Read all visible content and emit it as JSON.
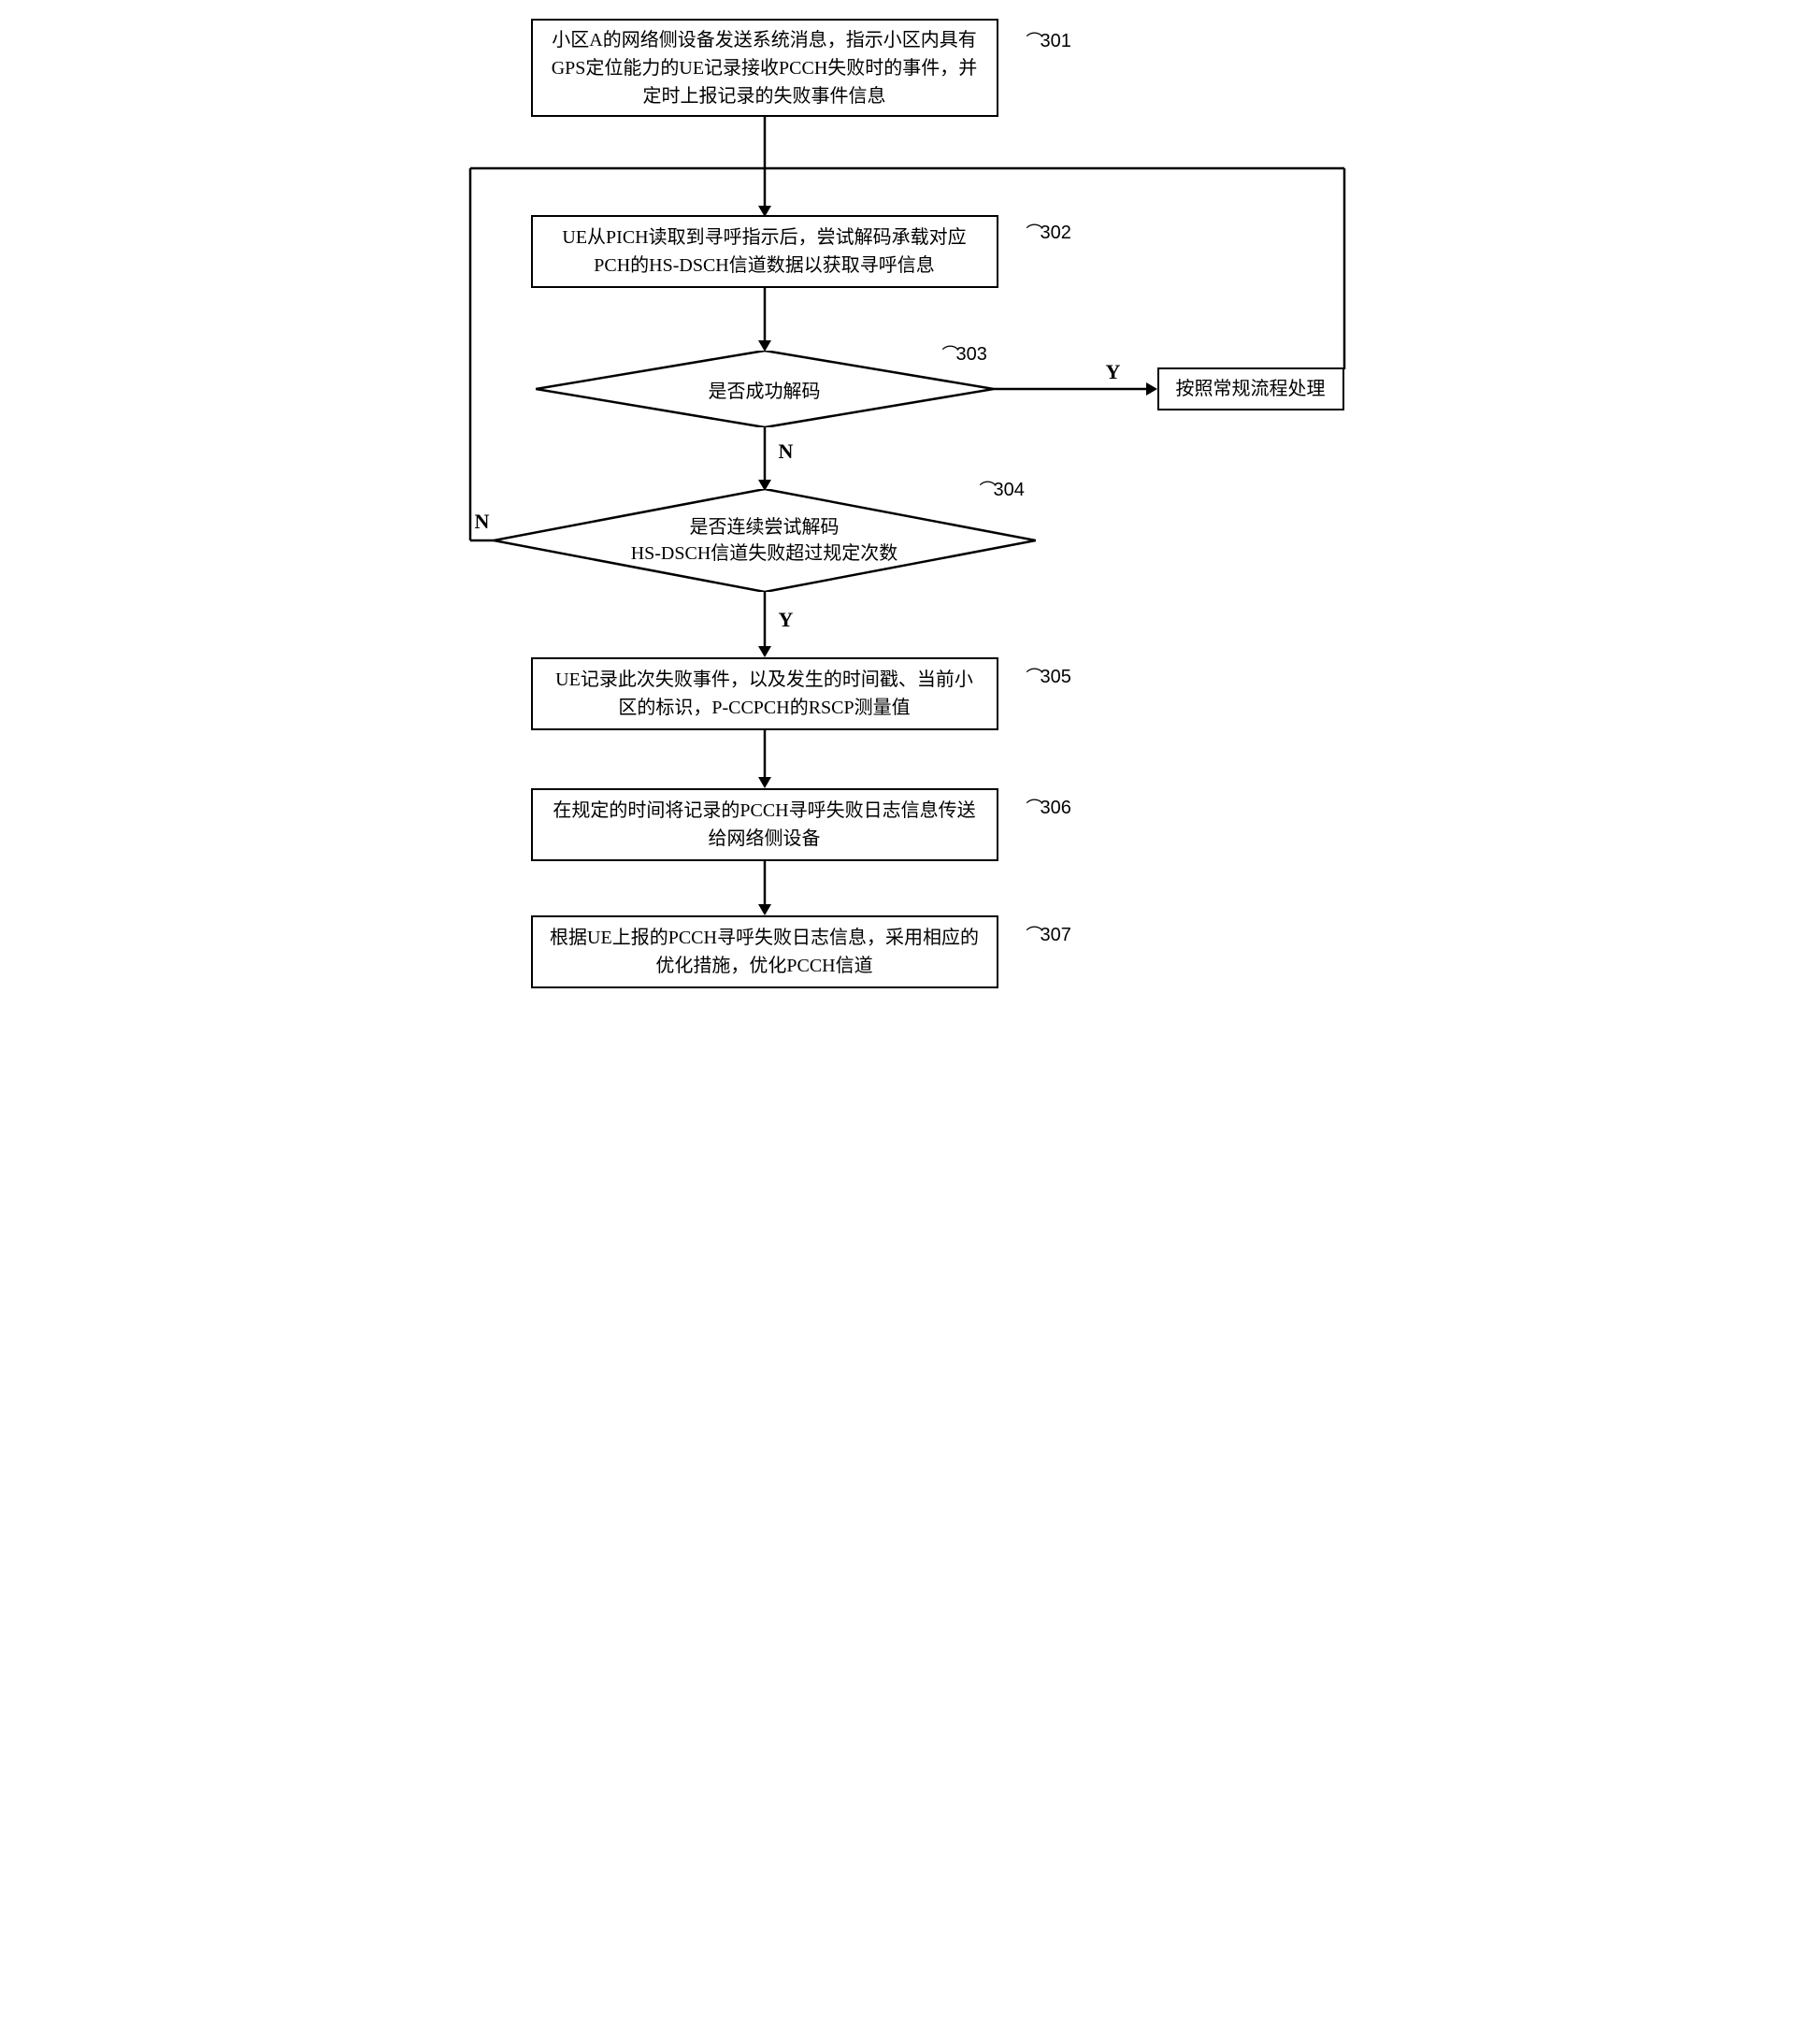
{
  "boxes": {
    "b301": "小区A的网络侧设备发送系统消息，指示小区内具有GPS定位能力的UE记录接收PCCH失败时的事件，并定时上报记录的失败事件信息",
    "b302": "UE从PICH读取到寻呼指示后，尝试解码承载对应PCH的HS-DSCH信道数据以获取寻呼信息",
    "d303": "是否成功解码",
    "d304_line1": "是否连续尝试解码",
    "d304_line2": "HS-DSCH信道失败超过规定次数",
    "b305": "UE记录此次失败事件，以及发生的时间戳、当前小区的标识，P-CCPCH的RSCP测量值",
    "b306": "在规定的时间将记录的PCCH寻呼失败日志信息传送给网络侧设备",
    "b307": "根据UE上报的PCCH寻呼失败日志信息，采用相应的优化措施，优化PCCH信道",
    "bNormal": "按照常规流程处理"
  },
  "labels": {
    "l301": "301",
    "l302": "302",
    "l303": "303",
    "l304": "304",
    "l305": "305",
    "l306": "306",
    "l307": "307",
    "Y": "Y",
    "N": "N"
  }
}
